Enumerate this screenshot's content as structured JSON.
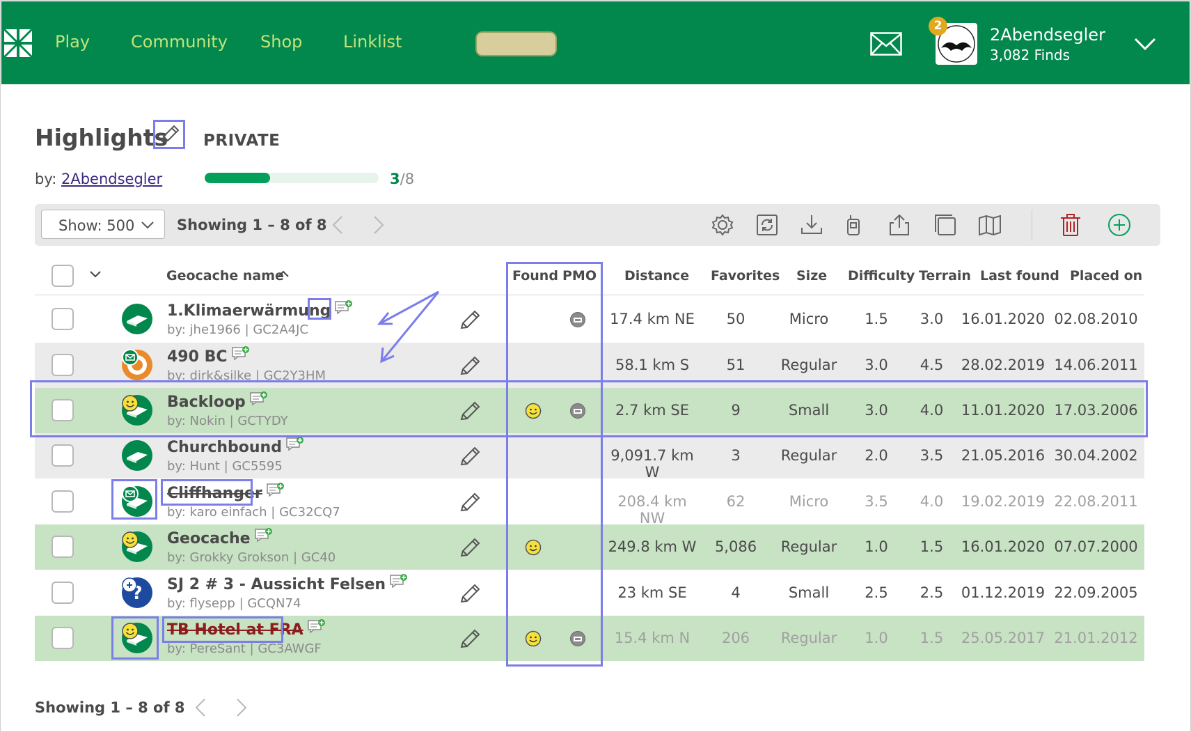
{
  "header": {
    "nav": [
      "Play",
      "Community",
      "Shop",
      "Linklist"
    ],
    "user": {
      "name": "2Abendsegler",
      "finds": "3,082 Finds",
      "notifications": "2"
    },
    "icons": [
      "geocaching-logo",
      "mail-icon",
      "avatar",
      "chevron-down-icon"
    ],
    "colors": {
      "bar": "#02874d",
      "nav_text": "#c4e37a"
    }
  },
  "list": {
    "title": "Highlights",
    "visibility": "PRIVATE",
    "by_label": "by:",
    "owner": "2Abendsegler",
    "progress": {
      "done": "3",
      "total": "/8",
      "fraction": 0.375
    }
  },
  "toolbar": {
    "show_label": "Show: 500",
    "showing": "Showing 1 – 8 of 8",
    "icons": [
      "settings-icon",
      "refresh-icon",
      "download-icon",
      "gps-icon",
      "share-icon",
      "copy-icon",
      "map-icon",
      "delete-icon",
      "add-icon"
    ]
  },
  "table": {
    "headers": {
      "name": "Geocache name",
      "found": "Found",
      "pmo": "PMO",
      "distance": "Distance",
      "favorites": "Favorites",
      "size": "Size",
      "difficulty": "Difficulty",
      "terrain": "Terrain",
      "last_found": "Last found",
      "placed_on": "Placed on"
    },
    "rows": [
      {
        "name": "1.Klimaerwärmung",
        "by": "by: jhe1966 | GC2A4JC",
        "distance": "17.4 km NE",
        "favorites": "50",
        "size": "Micro",
        "difficulty": "1.5",
        "terrain": "3.0",
        "last_found": "16.01.2020",
        "placed_on": "02.08.2010",
        "found": false,
        "pmo": true,
        "icon": "traditional-cache-icon"
      },
      {
        "name": "490 BC",
        "by": "by: dirk&silke | GC2Y3HM",
        "distance": "58.1 km S",
        "favorites": "51",
        "size": "Regular",
        "difficulty": "3.0",
        "terrain": "4.5",
        "last_found": "28.02.2019",
        "placed_on": "14.06.2011",
        "found": false,
        "pmo": false,
        "icon": "multi-cache-icon"
      },
      {
        "name": "Backloop",
        "by": "by: Nokin | GCTYDY",
        "distance": "2.7 km SE",
        "favorites": "9",
        "size": "Small",
        "difficulty": "3.0",
        "terrain": "4.0",
        "last_found": "11.01.2020",
        "placed_on": "17.03.2006",
        "found": true,
        "pmo": true,
        "icon": "found-traditional-icon"
      },
      {
        "name": "Churchbound",
        "by": "by: Hunt | GC5595",
        "distance": "9,091.7 km W",
        "favorites": "3",
        "size": "Regular",
        "difficulty": "2.0",
        "terrain": "3.5",
        "last_found": "21.05.2016",
        "placed_on": "30.04.2002",
        "found": false,
        "pmo": false,
        "icon": "traditional-cache-icon"
      },
      {
        "name": "Cliffhanger",
        "by": "by: karo einfach | GC32CQ7",
        "distance": "208.4 km NW",
        "favorites": "62",
        "size": "Micro",
        "difficulty": "3.5",
        "terrain": "4.0",
        "last_found": "19.02.2019",
        "placed_on": "22.08.2011",
        "found": false,
        "pmo": false,
        "icon": "disabled-cache-icon"
      },
      {
        "name": "Geocache",
        "by": "by: Grokky Grokson | GC40",
        "distance": "249.8 km W",
        "favorites": "5,086",
        "size": "Regular",
        "difficulty": "1.0",
        "terrain": "1.5",
        "last_found": "16.01.2020",
        "placed_on": "07.07.2000",
        "found": true,
        "pmo": false,
        "icon": "found-traditional-icon"
      },
      {
        "name": "SJ 2 # 3 - Aussicht Felsen",
        "by": "by: flysepp | GCQN74",
        "distance": "23 km SE",
        "favorites": "4",
        "size": "Small",
        "difficulty": "2.5",
        "terrain": "2.5",
        "last_found": "01.12.2019",
        "placed_on": "22.09.2005",
        "found": false,
        "pmo": false,
        "icon": "mystery-cache-icon"
      },
      {
        "name": "TB Hotel at FRA",
        "by": "by: PereSant | GC3AWGF",
        "distance": "15.4 km N",
        "favorites": "206",
        "size": "Regular",
        "difficulty": "1.0",
        "terrain": "1.5",
        "last_found": "25.05.2017",
        "placed_on": "21.01.2012",
        "found": true,
        "pmo": true,
        "icon": "archived-found-icon"
      }
    ]
  },
  "footer": {
    "showing": "Showing 1 – 8 of 8"
  }
}
